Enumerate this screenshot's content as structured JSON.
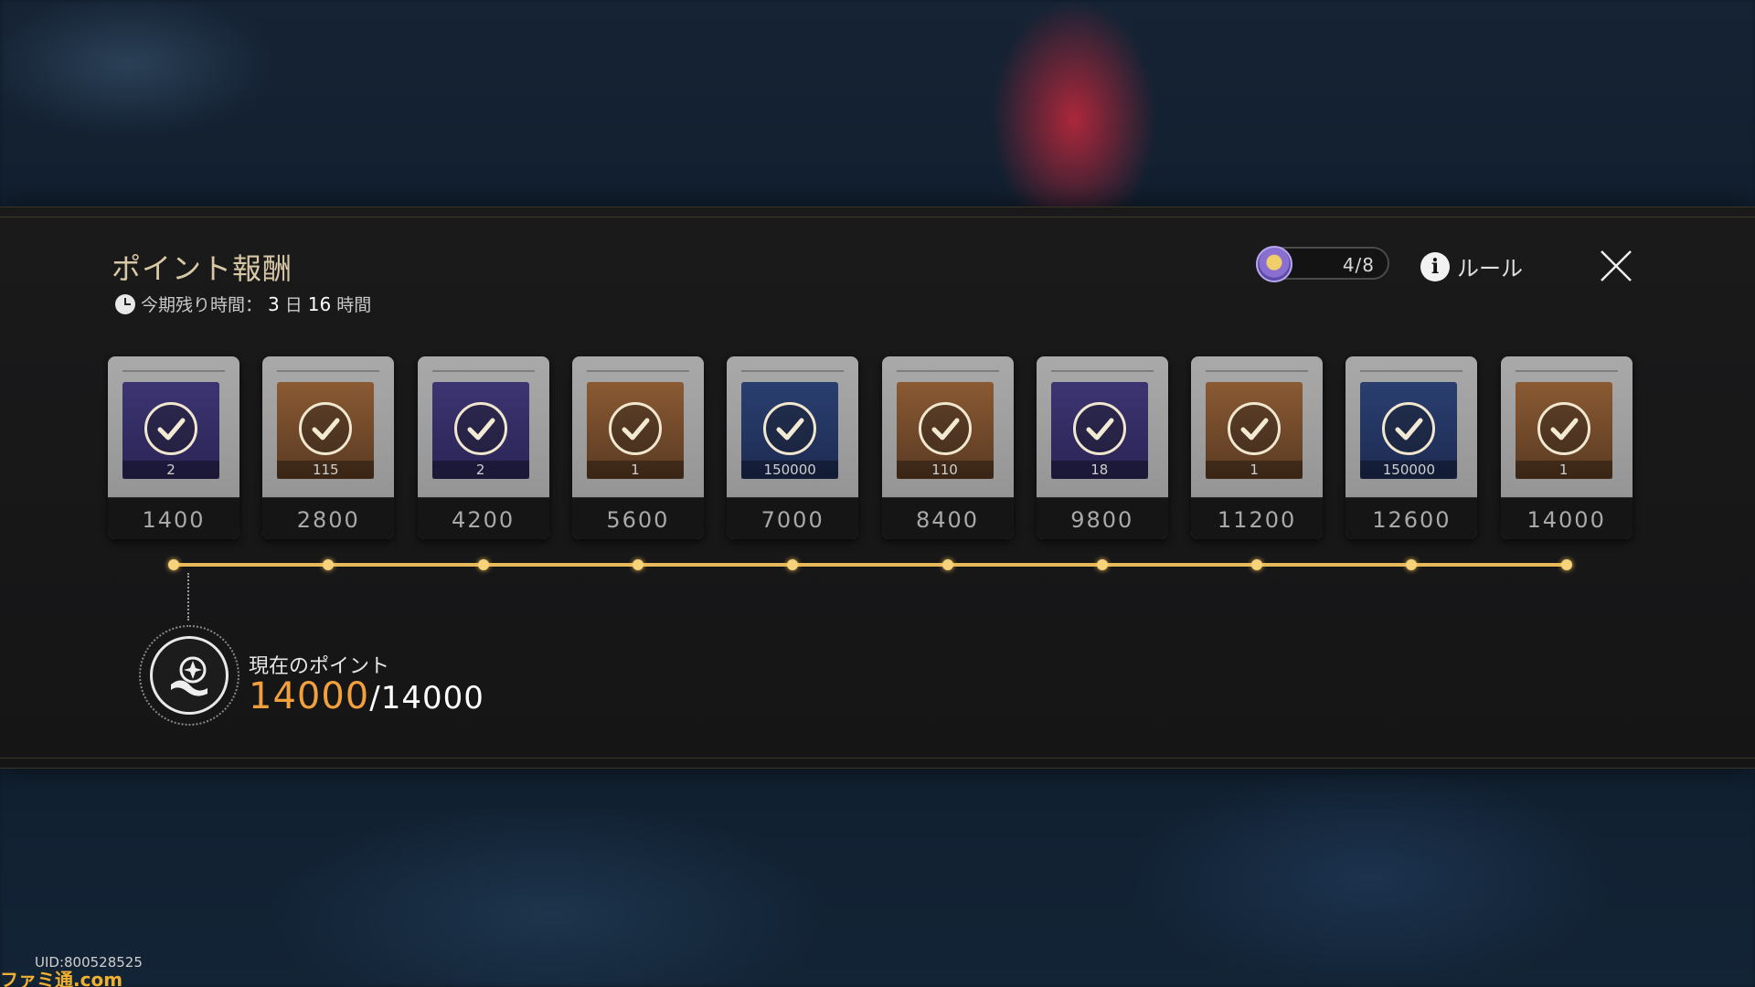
{
  "header": {
    "title": "ポイント報酬",
    "timer_label": "今期残り時間：",
    "timer_days": "3",
    "timer_days_unit": "日",
    "timer_hours": "16",
    "timer_hours_unit": "時間"
  },
  "counter": {
    "text": "4/8"
  },
  "rules": {
    "label": "ルール"
  },
  "rewards": [
    {
      "qty": "2",
      "points": "1400",
      "bg": "purple"
    },
    {
      "qty": "115",
      "points": "2800",
      "bg": "orange"
    },
    {
      "qty": "2",
      "points": "4200",
      "bg": "purple"
    },
    {
      "qty": "1",
      "points": "5600",
      "bg": "orange"
    },
    {
      "qty": "150000",
      "points": "7000",
      "bg": "blue"
    },
    {
      "qty": "110",
      "points": "8400",
      "bg": "orange"
    },
    {
      "qty": "18",
      "points": "9800",
      "bg": "purple"
    },
    {
      "qty": "1",
      "points": "11200",
      "bg": "orange"
    },
    {
      "qty": "150000",
      "points": "12600",
      "bg": "blue"
    },
    {
      "qty": "1",
      "points": "14000",
      "bg": "orange"
    }
  ],
  "current": {
    "label": "現在のポイント",
    "value": "14000",
    "total": "/14000"
  },
  "footer": {
    "uid": "UID:800528525",
    "watermark": "ファミ通.com"
  },
  "colors": {
    "accent": "#f2a03d",
    "track": "#e8b95a"
  }
}
